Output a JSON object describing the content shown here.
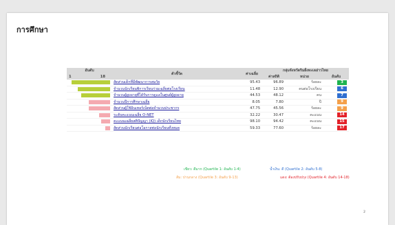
{
  "title": "การศึกษา",
  "table": {
    "headers": {
      "rank": "อันดับ",
      "rank_low": "1",
      "rank_high": "18",
      "indicator": "ตัวชี้วัด",
      "value": "ค่าเฉลี่ย",
      "group": "กลุ่มจังหวัดริมฝั่งทะเลอ่าวไทย",
      "standard": "ค่าสถิติ",
      "unit": "หน่วย",
      "group_rank": "อันดับ"
    },
    "rows": [
      {
        "indicator": "สัดส่วนเด็กที่มีพัฒนาการสมวัย",
        "value": "95.43",
        "standard": "96.89",
        "unit": "ร้อยละ",
        "rank": "3",
        "bar_color": "#b7cf3a",
        "rank_color": "#1eb34f",
        "bar_fraction": 0.93
      },
      {
        "indicator": "จำนวนนักเรียนพิการเรียนร่วมเฉลี่ยต่อโรงเรียน",
        "value": "11.48",
        "standard": "12.90",
        "unit": "คนต่อโรงเรียน",
        "rank": "6",
        "bar_color": "#b7cf3a",
        "rank_color": "#2f6fd0",
        "bar_fraction": 0.78
      },
      {
        "indicator": "จำนวนผู้สูงอายุที่ได้รับการดูแลในศูนย์ผู้สูงอายุ",
        "value": "44.53",
        "standard": "48.12",
        "unit": "คน",
        "rank": "7",
        "bar_color": "#b7cf3a",
        "rank_color": "#2f6fd0",
        "bar_fraction": 0.7
      },
      {
        "indicator": "จำนวนปีการศึกษาเฉลี่ย",
        "value": "8.05",
        "standard": "7.80",
        "unit": "ปี",
        "rank": "9",
        "bar_color": "#f4aab0",
        "rank_color": "#f4a04a",
        "bar_fraction": 0.52
      },
      {
        "indicator": "สัดส่วนผู้ใช้อินเทอร์เน็ตต่อจำนวนประชากร",
        "value": "47.75",
        "standard": "45.56",
        "unit": "ร้อยละ",
        "rank": "9",
        "bar_color": "#f4aab0",
        "rank_color": "#f4a04a",
        "bar_fraction": 0.52
      },
      {
        "indicator": "ระดับคะแนนเฉลี่ย O-NET",
        "value": "32.22",
        "standard": "30.47",
        "unit": "คะแนน",
        "rank": "14",
        "bar_color": "#f4aab0",
        "rank_color": "#e32129",
        "bar_fraction": 0.27
      },
      {
        "indicator": "คะแนนเฉลี่ยสติปัญญา (IQ) เด็กนักเรียนไทย",
        "value": "98.10",
        "standard": "94.42",
        "unit": "คะแนน",
        "rank": "15",
        "bar_color": "#f4aab0",
        "rank_color": "#e32129",
        "bar_fraction": 0.22
      },
      {
        "indicator": "สัดส่วนนักเรียนต่อโอกาสต่อนักเรียนทั้งหมด",
        "value": "59.33",
        "standard": "77.60",
        "unit": "ร้อยละ",
        "rank": "17",
        "bar_color": "#f4aab0",
        "rank_color": "#e32129",
        "bar_fraction": 0.11
      }
    ]
  },
  "legend": {
    "green": "เขียว: ดีมาก (Quartile 1: อันดับ 1-4)",
    "blue": "น้ำเงิน: ดี (Quartile 2: อันดับ 5-8)",
    "orange": "ส้ม: ปานกลาง (Quartile 3: อันดับ 9-13)",
    "red": "แดง: ต้องปรับปรุง (Quartile 4: อันดับ 14-18)",
    "colors": {
      "green": "#1eb34f",
      "blue": "#2f6fd0",
      "orange": "#f4a04a",
      "red": "#e32129"
    }
  },
  "page_number": "2"
}
